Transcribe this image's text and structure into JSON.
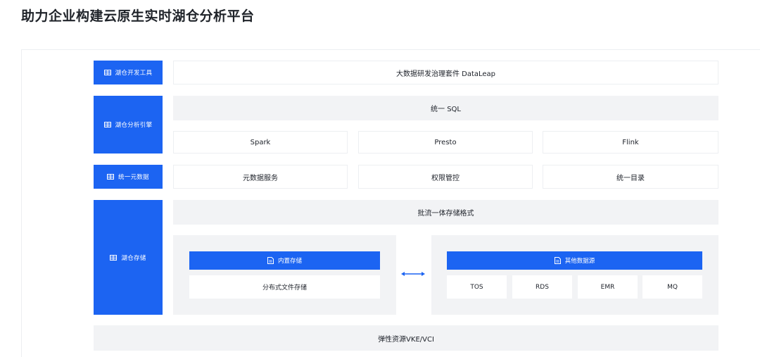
{
  "title": "助力企业构建云原生实时湖仓分析平台",
  "rows": {
    "dev_tools": {
      "label": "湖仓开发工具",
      "content": "大数据研发治理套件 DataLeap"
    },
    "analysis_engine": {
      "label": "湖仓分析引擎",
      "sql": "统一 SQL",
      "engines": [
        "Spark",
        "Presto",
        "Flink"
      ]
    },
    "metadata": {
      "label": "统一元数据",
      "items": [
        "元数据服务",
        "权限管控",
        "统一目录"
      ]
    },
    "storage": {
      "label": "湖仓存储",
      "format": "批流一体存储格式",
      "builtin": {
        "title": "内置存储",
        "content": "分布式文件存储"
      },
      "other": {
        "title": "其他数据源",
        "items": [
          "TOS",
          "RDS",
          "EMR",
          "MQ"
        ]
      }
    }
  },
  "footer": "弹性资源VKE/VCI",
  "colors": {
    "accent": "#1c64f2",
    "gray_block": "#f2f3f5"
  },
  "icons": {
    "side": "table-icon",
    "header": "document-icon",
    "link": "double-arrow-icon"
  }
}
